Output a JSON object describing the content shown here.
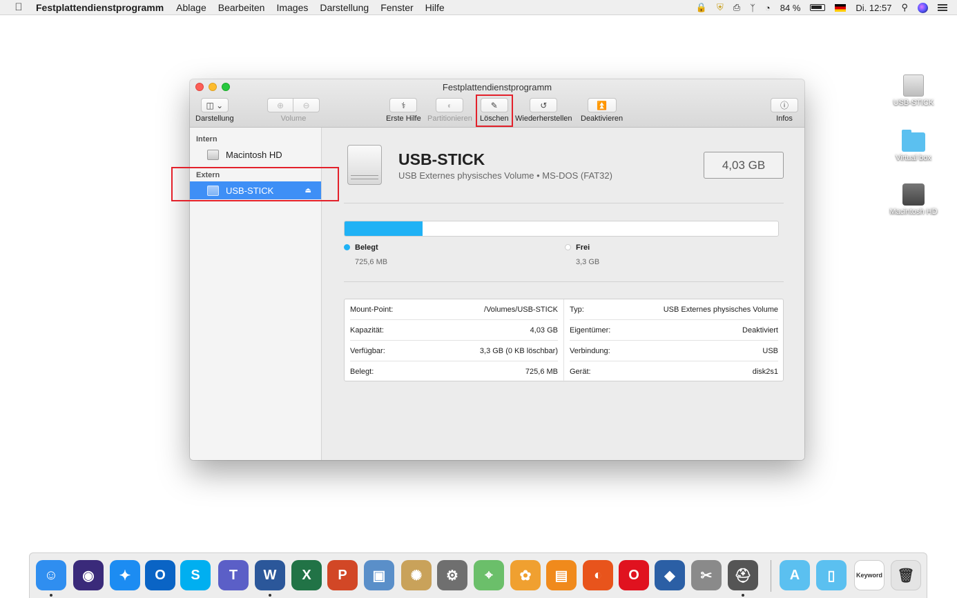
{
  "menubar": {
    "app_name": "Festplattendienstprogramm",
    "items": [
      "Ablage",
      "Bearbeiten",
      "Images",
      "Darstellung",
      "Fenster",
      "Hilfe"
    ],
    "battery": "84 %",
    "clock": "Di. 12:57"
  },
  "desktop": {
    "icons": [
      {
        "label": "USB-STICK",
        "icon": "usb-drive-icon"
      },
      {
        "label": "Virtual box",
        "icon": "folder-icon"
      },
      {
        "label": "Macintosh HD",
        "icon": "hard-disk-icon"
      }
    ]
  },
  "window": {
    "title": "Festplattendienstprogramm",
    "toolbar": {
      "view_label": "Darstellung",
      "volume_label": "Volume",
      "first_aid_label": "Erste Hilfe",
      "partition_label": "Partitionieren",
      "erase_label": "Löschen",
      "restore_label": "Wiederherstellen",
      "unmount_label": "Deaktivieren",
      "info_label": "Infos"
    },
    "sidebar": {
      "internal_header": "Intern",
      "internal_item": "Macintosh HD",
      "external_header": "Extern",
      "external_item": "USB-STICK"
    },
    "volume": {
      "name": "USB-STICK",
      "subtitle": "USB Externes physisches Volume • MS-DOS (FAT32)",
      "size": "4,03 GB",
      "used_fraction": 0.18,
      "used_label": "Belegt",
      "used_value": "725,6 MB",
      "used_color": "#20b2f5",
      "free_label": "Frei",
      "free_value": "3,3 GB",
      "free_color": "#ffffff"
    },
    "info": {
      "left": [
        {
          "label": "Mount-Point:",
          "value": "/Volumes/USB-STICK"
        },
        {
          "label": "Kapazität:",
          "value": "4,03 GB"
        },
        {
          "label": "Verfügbar:",
          "value": "3,3 GB (0 KB löschbar)"
        },
        {
          "label": "Belegt:",
          "value": "725,6 MB"
        }
      ],
      "right": [
        {
          "label": "Typ:",
          "value": "USB Externes physisches Volume"
        },
        {
          "label": "Eigentümer:",
          "value": "Deaktiviert"
        },
        {
          "label": "Verbindung:",
          "value": "USB"
        },
        {
          "label": "Gerät:",
          "value": "disk2s1"
        }
      ]
    }
  },
  "dock": {
    "apps": [
      {
        "name": "finder-icon",
        "glyph": "☺",
        "color": "#2f8ef0"
      },
      {
        "name": "siri-icon",
        "glyph": "◉",
        "color": "#3a2a7a"
      },
      {
        "name": "safari-icon",
        "glyph": "✦",
        "color": "#1c8cf2"
      },
      {
        "name": "outlook-icon",
        "glyph": "O",
        "color": "#0a64c5"
      },
      {
        "name": "skype-icon",
        "glyph": "S",
        "color": "#00aff0"
      },
      {
        "name": "teams-icon",
        "glyph": "T",
        "color": "#5b5fc7"
      },
      {
        "name": "word-icon",
        "glyph": "W",
        "color": "#2b579a"
      },
      {
        "name": "excel-icon",
        "glyph": "X",
        "color": "#217346"
      },
      {
        "name": "powerpoint-icon",
        "glyph": "P",
        "color": "#d24726"
      },
      {
        "name": "preview-icon",
        "glyph": "▣",
        "color": "#5a8fc9"
      },
      {
        "name": "sunflower-icon",
        "glyph": "✺",
        "color": "#c9a25a"
      },
      {
        "name": "system-preferences-icon",
        "glyph": "⚙",
        "color": "#6f6f6f"
      },
      {
        "name": "maps-icon",
        "glyph": "⌖",
        "color": "#6bbf6a"
      },
      {
        "name": "photos-icon",
        "glyph": "✿",
        "color": "#f0a030"
      },
      {
        "name": "ibooks-icon",
        "glyph": "▤",
        "color": "#f08a1c"
      },
      {
        "name": "firefox-icon",
        "glyph": "◐",
        "color": "#e8541c"
      },
      {
        "name": "opera-icon",
        "glyph": "O",
        "color": "#e0121f"
      },
      {
        "name": "virtualbox-icon",
        "glyph": "◆",
        "color": "#2b5fa5"
      },
      {
        "name": "scissors-icon",
        "glyph": "✂",
        "color": "#8a8a8a"
      },
      {
        "name": "disk-utility-icon",
        "glyph": "⛑",
        "color": "#555555"
      },
      {
        "name": "applications-folder-icon",
        "glyph": "A",
        "color": "#5bc0f0"
      },
      {
        "name": "documents-folder-icon",
        "glyph": "▯",
        "color": "#5bc0f0"
      },
      {
        "name": "keyword-file-icon",
        "glyph": "Keyword",
        "color": "#ffffff"
      },
      {
        "name": "trash-icon",
        "glyph": "🗑",
        "color": "#e4e4e4"
      }
    ]
  }
}
